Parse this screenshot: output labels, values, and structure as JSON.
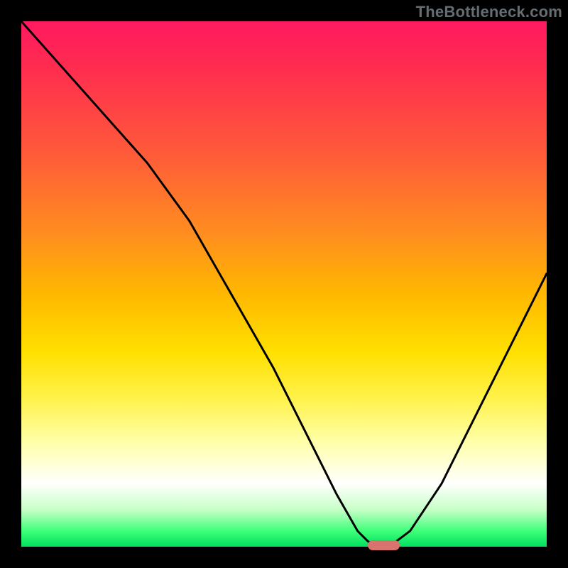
{
  "watermark": "TheBottleneck.com",
  "colors": {
    "frame": "#000000",
    "curve": "#000000",
    "marker": "#d9736e"
  },
  "chart_data": {
    "type": "line",
    "title": "",
    "xlabel": "",
    "ylabel": "",
    "xlim": [
      0,
      100
    ],
    "ylim": [
      0,
      100
    ],
    "grid": false,
    "legend": false,
    "background": "vertical-gradient red→yellow→green",
    "series": [
      {
        "name": "bottleneck-curve",
        "x": [
          0,
          8,
          16,
          24,
          32,
          40,
          48,
          56,
          60,
          64,
          66,
          68,
          70,
          74,
          80,
          88,
          96,
          100
        ],
        "values": [
          100,
          91,
          82,
          73,
          62,
          48,
          34,
          18,
          10,
          3,
          1,
          0,
          0,
          3,
          12,
          28,
          44,
          52
        ]
      }
    ],
    "marker": {
      "x_start": 66,
      "x_end": 72,
      "y": 0,
      "shape": "pill"
    },
    "gradient_stops": [
      {
        "pos": 0,
        "color": "#ff1a60"
      },
      {
        "pos": 25,
        "color": "#ff5a3a"
      },
      {
        "pos": 52,
        "color": "#ffb800"
      },
      {
        "pos": 72,
        "color": "#fff24d"
      },
      {
        "pos": 88,
        "color": "#ffffff"
      },
      {
        "pos": 97,
        "color": "#3fff7a"
      },
      {
        "pos": 100,
        "color": "#00e060"
      }
    ]
  }
}
